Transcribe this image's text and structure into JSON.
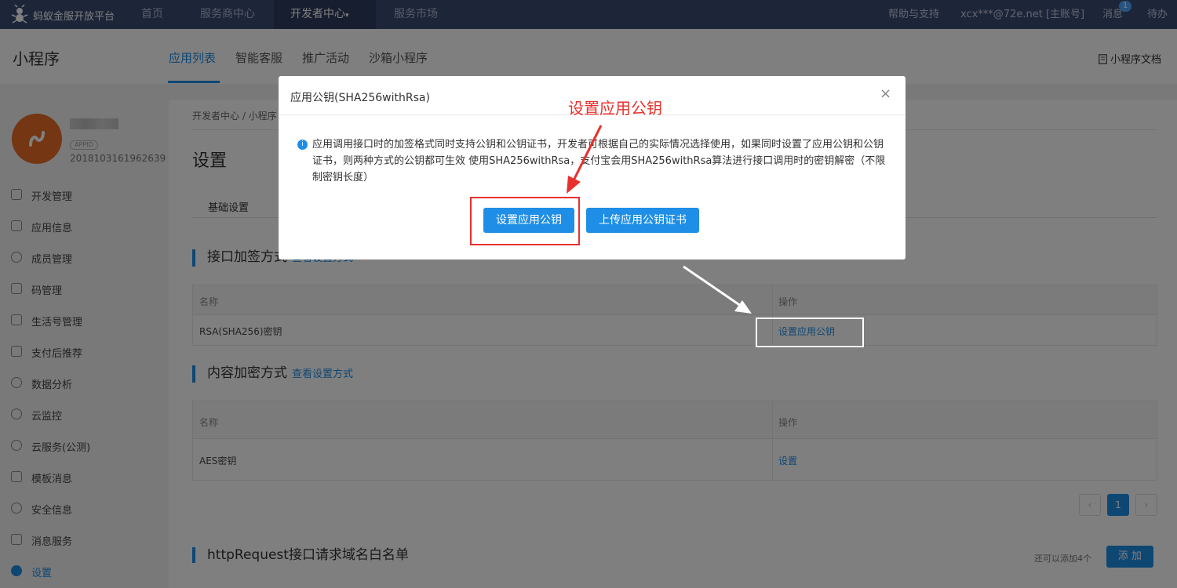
{
  "topbar": {
    "brand": "蚂蚁金服开放平台",
    "nav": [
      "首页",
      "服务商中心",
      "开发者中心",
      "服务市场"
    ],
    "active_caret": "▾",
    "help": "帮助与支持",
    "account": "xcx***@72e.net [主账号]",
    "messages": "消息",
    "message_count": "1",
    "todo": "待办"
  },
  "subheader": {
    "title": "小程序",
    "tabs": [
      "应用列表",
      "智能客服",
      "推广活动",
      "沙箱小程序"
    ],
    "doc_link": "小程序文档"
  },
  "sidebar": {
    "appid_tag": "APPID",
    "appid": "2018103161962639",
    "items": [
      {
        "label": "开发管理",
        "icon": "code-icon"
      },
      {
        "label": "应用信息",
        "icon": "grid-icon"
      },
      {
        "label": "成员管理",
        "icon": "user-icon"
      },
      {
        "label": "码管理",
        "icon": "qrcode-icon"
      },
      {
        "label": "生活号管理",
        "icon": "life-icon"
      },
      {
        "label": "支付后推荐",
        "icon": "monitor-icon"
      },
      {
        "label": "数据分析",
        "icon": "pie-icon"
      },
      {
        "label": "云监控",
        "icon": "cloud-icon"
      },
      {
        "label": "云服务(公测)",
        "icon": "cloud-service-icon"
      },
      {
        "label": "模板消息",
        "icon": "message-icon"
      },
      {
        "label": "安全信息",
        "icon": "shield-icon"
      },
      {
        "label": "消息服务",
        "icon": "chart-icon"
      },
      {
        "label": "设置",
        "icon": "gear-icon"
      }
    ]
  },
  "main": {
    "breadcrumb": "开发者中心 / 小程序",
    "page_title": "设置",
    "subtab": "基础设置",
    "section1": {
      "title": "接口加签方式",
      "link": "查看设置方式"
    },
    "table1": {
      "headers": [
        "名称",
        "操作"
      ],
      "rows": [
        {
          "name": "RSA(SHA256)密钥",
          "action": "设置应用公钥"
        }
      ]
    },
    "section2": {
      "title": "内容加密方式",
      "link": "查看设置方式"
    },
    "table2": {
      "headers": [
        "名称",
        "操作"
      ],
      "rows": [
        {
          "name": "AES密钥",
          "action": "设置"
        }
      ]
    },
    "pager": {
      "prev": "‹",
      "current": "1",
      "next": "›"
    },
    "section3": {
      "title": "httpRequest接口请求域名白名单"
    },
    "quota": "还可以添加4个",
    "add_button": "添 加"
  },
  "modal": {
    "title": "应用公钥(SHA256withRsa)",
    "close": "×",
    "info_icon": "i",
    "description": "应用调用接口时的加签格式同时支持公钥和公钥证书，开发者可根据自己的实际情况选择使用，如果同时设置了应用公钥和公钥证书，则两种方式的公钥都可生效 使用SHA256withRsa，支付宝会用SHA256withRsa算法进行接口调用时的密钥解密（不限制密钥长度）",
    "primary_button": "设置应用公钥",
    "secondary_button": "上传应用公钥证书"
  },
  "annotation": {
    "label": "设置应用公钥",
    "color": "#e8302c"
  },
  "colors": {
    "accent": "#1e8ee6",
    "topbar": "#3a4a73",
    "avatar": "#e86d26"
  }
}
